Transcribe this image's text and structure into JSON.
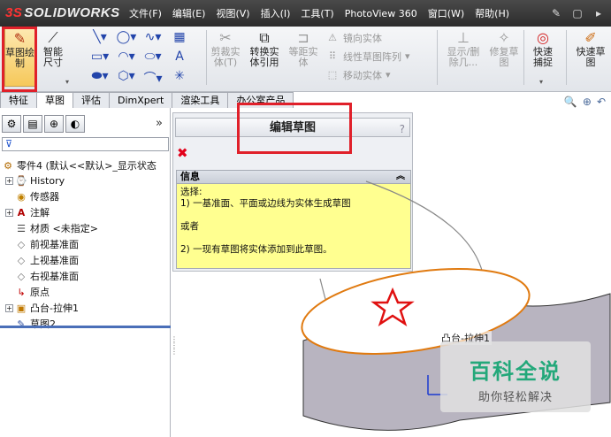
{
  "app": {
    "logo_text": "SOLIDWORKS",
    "logo_mark": "3S"
  },
  "menubar": {
    "items": [
      "文件(F)",
      "编辑(E)",
      "视图(V)",
      "插入(I)",
      "工具(T)",
      "PhotoView 360",
      "窗口(W)",
      "帮助(H)"
    ]
  },
  "toolbar": {
    "sketch_label": "草图绘制",
    "smart_dim_label": "智能尺寸",
    "trim_label": "剪裁实体(T)",
    "convert_label": "转换实体引用",
    "offset_label": "等距实体",
    "mirror_label": "镜向实体",
    "linear_pattern_label": "线性草图阵列",
    "move_label": "移动实体",
    "show_delete_label": "显示/删除几...",
    "repair_label": "修复草图",
    "quick_snap_label": "快速捕捉",
    "quick_sketch_label": "快速草图"
  },
  "tabs": [
    "特征",
    "草图",
    "评估",
    "DimXpert",
    "渲染工具",
    "办公室产品"
  ],
  "active_tab": "草图",
  "feature_tree": {
    "root": "零件4 (默认<<默认>_显示状态",
    "items": [
      {
        "label": "History",
        "icon": "history-icon"
      },
      {
        "label": "传感器",
        "icon": "sensor-icon"
      },
      {
        "label": "注解",
        "icon": "annotation-icon"
      },
      {
        "label": "材质 <未指定>",
        "icon": "material-icon"
      },
      {
        "label": "前视基准面",
        "icon": "plane-icon"
      },
      {
        "label": "上视基准面",
        "icon": "plane-icon"
      },
      {
        "label": "右视基准面",
        "icon": "plane-icon"
      },
      {
        "label": "原点",
        "icon": "origin-icon"
      },
      {
        "label": "凸台-拉伸1",
        "icon": "extrude-icon"
      },
      {
        "label": "草图2",
        "icon": "sketch-icon"
      }
    ]
  },
  "property_manager": {
    "title": "编辑草图",
    "help": "?",
    "info_header": "信息",
    "info_lines": [
      "选择:",
      "1) 一基准面、平面或边线为实体生成草图",
      "",
      "或者",
      "",
      "2) 一现有草图将实体添加到此草图。"
    ]
  },
  "graphics": {
    "body_label": "凸台-拉伸1",
    "watermark_title": "百科全说",
    "watermark_subtitle": "助你轻松解决"
  },
  "colors": {
    "highlight_red": "#e0202a",
    "info_yellow": "#ffff90",
    "watermark_green": "#23a87a"
  }
}
